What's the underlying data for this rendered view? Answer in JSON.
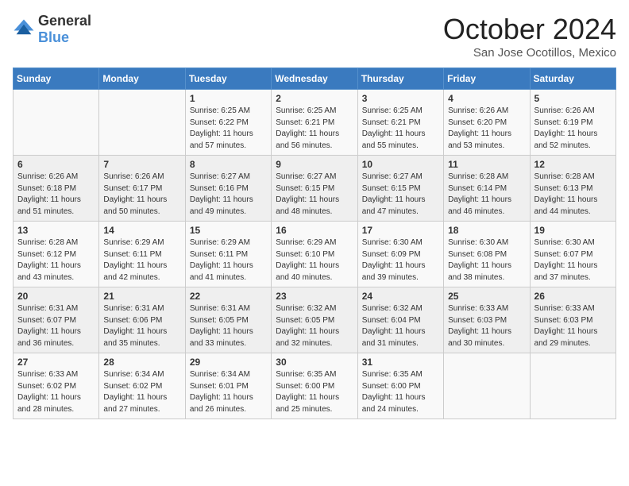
{
  "header": {
    "logo": {
      "general": "General",
      "blue": "Blue"
    },
    "title": "October 2024",
    "location": "San Jose Ocotillos, Mexico"
  },
  "weekdays": [
    "Sunday",
    "Monday",
    "Tuesday",
    "Wednesday",
    "Thursday",
    "Friday",
    "Saturday"
  ],
  "weeks": [
    [
      null,
      null,
      {
        "day": 1,
        "sunrise": "6:25 AM",
        "sunset": "6:22 PM",
        "daylight": "11 hours and 57 minutes."
      },
      {
        "day": 2,
        "sunrise": "6:25 AM",
        "sunset": "6:21 PM",
        "daylight": "11 hours and 56 minutes."
      },
      {
        "day": 3,
        "sunrise": "6:25 AM",
        "sunset": "6:21 PM",
        "daylight": "11 hours and 55 minutes."
      },
      {
        "day": 4,
        "sunrise": "6:26 AM",
        "sunset": "6:20 PM",
        "daylight": "11 hours and 53 minutes."
      },
      {
        "day": 5,
        "sunrise": "6:26 AM",
        "sunset": "6:19 PM",
        "daylight": "11 hours and 52 minutes."
      }
    ],
    [
      {
        "day": 6,
        "sunrise": "6:26 AM",
        "sunset": "6:18 PM",
        "daylight": "11 hours and 51 minutes."
      },
      {
        "day": 7,
        "sunrise": "6:26 AM",
        "sunset": "6:17 PM",
        "daylight": "11 hours and 50 minutes."
      },
      {
        "day": 8,
        "sunrise": "6:27 AM",
        "sunset": "6:16 PM",
        "daylight": "11 hours and 49 minutes."
      },
      {
        "day": 9,
        "sunrise": "6:27 AM",
        "sunset": "6:15 PM",
        "daylight": "11 hours and 48 minutes."
      },
      {
        "day": 10,
        "sunrise": "6:27 AM",
        "sunset": "6:15 PM",
        "daylight": "11 hours and 47 minutes."
      },
      {
        "day": 11,
        "sunrise": "6:28 AM",
        "sunset": "6:14 PM",
        "daylight": "11 hours and 46 minutes."
      },
      {
        "day": 12,
        "sunrise": "6:28 AM",
        "sunset": "6:13 PM",
        "daylight": "11 hours and 44 minutes."
      }
    ],
    [
      {
        "day": 13,
        "sunrise": "6:28 AM",
        "sunset": "6:12 PM",
        "daylight": "11 hours and 43 minutes."
      },
      {
        "day": 14,
        "sunrise": "6:29 AM",
        "sunset": "6:11 PM",
        "daylight": "11 hours and 42 minutes."
      },
      {
        "day": 15,
        "sunrise": "6:29 AM",
        "sunset": "6:11 PM",
        "daylight": "11 hours and 41 minutes."
      },
      {
        "day": 16,
        "sunrise": "6:29 AM",
        "sunset": "6:10 PM",
        "daylight": "11 hours and 40 minutes."
      },
      {
        "day": 17,
        "sunrise": "6:30 AM",
        "sunset": "6:09 PM",
        "daylight": "11 hours and 39 minutes."
      },
      {
        "day": 18,
        "sunrise": "6:30 AM",
        "sunset": "6:08 PM",
        "daylight": "11 hours and 38 minutes."
      },
      {
        "day": 19,
        "sunrise": "6:30 AM",
        "sunset": "6:07 PM",
        "daylight": "11 hours and 37 minutes."
      }
    ],
    [
      {
        "day": 20,
        "sunrise": "6:31 AM",
        "sunset": "6:07 PM",
        "daylight": "11 hours and 36 minutes."
      },
      {
        "day": 21,
        "sunrise": "6:31 AM",
        "sunset": "6:06 PM",
        "daylight": "11 hours and 35 minutes."
      },
      {
        "day": 22,
        "sunrise": "6:31 AM",
        "sunset": "6:05 PM",
        "daylight": "11 hours and 33 minutes."
      },
      {
        "day": 23,
        "sunrise": "6:32 AM",
        "sunset": "6:05 PM",
        "daylight": "11 hours and 32 minutes."
      },
      {
        "day": 24,
        "sunrise": "6:32 AM",
        "sunset": "6:04 PM",
        "daylight": "11 hours and 31 minutes."
      },
      {
        "day": 25,
        "sunrise": "6:33 AM",
        "sunset": "6:03 PM",
        "daylight": "11 hours and 30 minutes."
      },
      {
        "day": 26,
        "sunrise": "6:33 AM",
        "sunset": "6:03 PM",
        "daylight": "11 hours and 29 minutes."
      }
    ],
    [
      {
        "day": 27,
        "sunrise": "6:33 AM",
        "sunset": "6:02 PM",
        "daylight": "11 hours and 28 minutes."
      },
      {
        "day": 28,
        "sunrise": "6:34 AM",
        "sunset": "6:02 PM",
        "daylight": "11 hours and 27 minutes."
      },
      {
        "day": 29,
        "sunrise": "6:34 AM",
        "sunset": "6:01 PM",
        "daylight": "11 hours and 26 minutes."
      },
      {
        "day": 30,
        "sunrise": "6:35 AM",
        "sunset": "6:00 PM",
        "daylight": "11 hours and 25 minutes."
      },
      {
        "day": 31,
        "sunrise": "6:35 AM",
        "sunset": "6:00 PM",
        "daylight": "11 hours and 24 minutes."
      },
      null,
      null
    ]
  ],
  "labels": {
    "sunrise": "Sunrise:",
    "sunset": "Sunset:",
    "daylight": "Daylight:"
  }
}
